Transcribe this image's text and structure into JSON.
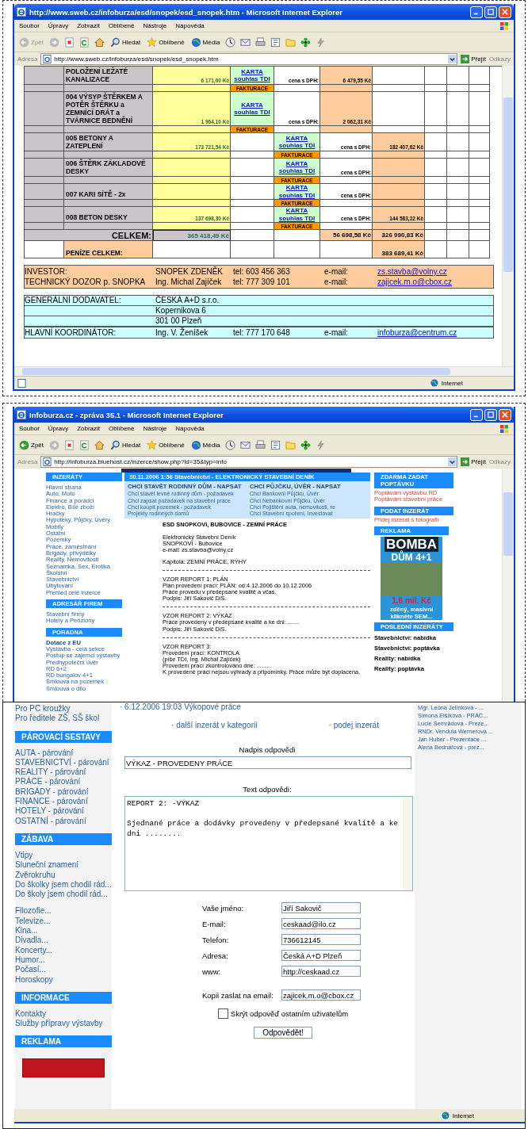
{
  "windows": [
    {
      "kind": "table",
      "title": "http://www.sweb.cz/infoburza/esd/snopek/esd_snopek.htm - Microsoft Internet Explorer",
      "menu": [
        "Soubor",
        "Úpravy",
        "Zobrazit",
        "Oblíbené",
        "Nástroje",
        "Nápověda"
      ],
      "toolbar": {
        "back": "Zpět",
        "back_disabled": true,
        "search": "Hledat",
        "favorites": "Oblíbené",
        "media": "Média"
      },
      "address": {
        "label": "Adresa",
        "url": "http://www.sweb.cz/infoburza/esd/snopek/esd_snopek.htm",
        "go": "Přejít",
        "links": "Odkazy"
      },
      "status": "Internet"
    },
    {
      "kind": "portal",
      "title": "Infoburza.cz - zpráva 35.1 - Microsoft Internet Explorer",
      "menu": [
        "Soubor",
        "Úpravy",
        "Zobrazit",
        "Oblíbené",
        "Nástroje",
        "Nápověda"
      ],
      "toolbar": {
        "back": "Zpět",
        "back_disabled": false,
        "search": "Hledat",
        "favorites": "Oblíbené",
        "media": "Média"
      },
      "address": {
        "label": "Adresa",
        "url": "http://infoburza.bluehost.cz/inzerce/show.php?id=35&typ=info",
        "go": "Přejít",
        "links": "Odkazy"
      }
    }
  ],
  "budget": {
    "items": [
      {
        "kind": "first",
        "name": "POLOŽENÍ LEŽATÉ KANALIZACE",
        "price": "6 171,00 Kč",
        "card": "KARTA souhlas TDI",
        "vat_label": "cena s DPH:",
        "vat_price": "6 479,55 Kč",
        "invoice": "FAKTURACE"
      },
      {
        "kind": "first",
        "name": "004 VÝSYP ŠTĚRKEM A POTĚR ŠTĚRKU a ZEMNÍCÍ DRÁT a TVÁRNICE BEDNĚNÍ",
        "price": "1 964,10 Kč",
        "card": "KARTA souhlas TDI",
        "vat_label": "cena s DPH:",
        "vat_price": "2 062,31 Kč",
        "invoice": "FAKTURACE"
      },
      {
        "kind": "second",
        "name": "005 BETONY A ZATEPLENÍ",
        "price": "173 721,54 Kč",
        "card": "KARTA souhlas TDI",
        "vat_label": "cena s DPH:",
        "vat_price": "182 407,62 Kč",
        "invoice": "FAKTURACE"
      },
      {
        "kind": "second",
        "name": "006 ŠTĚRK ZÁKLADOVÉ DESKY",
        "card": "KARTA souhlas TDI",
        "vat_label": "cena s DPH:",
        "invoice": "FAKTURACE"
      },
      {
        "kind": "second",
        "name": "007 KARI SÍTĚ - 2x",
        "card": "KARTA souhlas TDI",
        "vat_label": "cena s DPH:",
        "invoice": "FAKTURACE"
      },
      {
        "kind": "second",
        "name": "008 BETON DESKY",
        "price": "137 698,30 Kč",
        "card": "KARTA souhlas TDI",
        "vat_label": "cena s DPH:",
        "vat_price": "144 583,22 Kč",
        "invoice": "FAKTURACE"
      }
    ],
    "total": {
      "label": "CELKEM:",
      "price": "365 418,49 Kč",
      "vat_first": "56 698,58 Kč",
      "vat_second": "326 990,83 Kč"
    },
    "grand_total": {
      "label": "PENÍZE CELKEM:",
      "value": "383 689,41 Kč"
    },
    "contacts": [
      {
        "role": "INVESTOR:",
        "name": "SNOPEK ZDENĚK",
        "tel": "tel: 603 456 363",
        "email_label": "e-mail:",
        "email": "zs.stavba@volny.cz"
      },
      {
        "role": "TECHNICKÝ DOZOR p. SNOPKA",
        "name": "Ing. Michal Zajíček",
        "tel": "tel: 777 309 101",
        "email_label": "e-mail:",
        "email": "zajicek.m.o@cbox.cz"
      }
    ],
    "supplier": {
      "label": "GENERÁLNÍ DODAVATEL:",
      "lines": [
        "ČESKÁ A+D s.r.o.",
        "Kopernikova 6",
        "301 00 Plzeň"
      ]
    },
    "coordinator": {
      "role": "HLAVNÍ KOORDINÁTOR:",
      "name": "Ing. V. Ženíšek",
      "tel": "tel: 777 170 648",
      "email_label": "e-mail:",
      "email": "infoburza@centrum.cz"
    }
  },
  "portal": {
    "nav": [
      {
        "heading": "INZERÁTY",
        "items": [
          "Hlavní strana",
          "Auto, Moto",
          "Finance a poradci",
          "Elektro, Bílé zboží",
          "Hračky",
          "Hypotéky, Půjčky, Úvěry",
          "Mobily",
          "Ostatní",
          "Pozemky",
          "Práce, zaměstnání",
          "Brigády, přivýdělky",
          "Reality, Nemovitosti",
          "Seznamka, Sex, Erotika",
          "Školství",
          "Stavebnictví",
          "Ubytování",
          "Přehled celé inzerce"
        ]
      },
      {
        "heading": "ADRESÁŘ FIREM",
        "items": [
          "Stavební firmy",
          "Hotely a Penziony"
        ]
      },
      {
        "heading": "PORADNA",
        "lead": "Dotace z EU",
        "items": [
          "Výstavba - celá sekce",
          "Postup se zájemci výstavby",
          "Předhypoteční úvěr",
          "RD 6+2",
          "RD bungalov 4+1",
          "Smlouva na pozemek",
          "Smlouva o dílo"
        ]
      }
    ],
    "header": "30.11.2006 1:56 Stavebnictví - ELEKTRONICKÝ STAVEBNÍ DENÍK",
    "link_columns": [
      {
        "heading": "CHCI STAVĚT RODINNÝ DŮM - NAPSAT",
        "links": [
          "Chci stavět levně rodinný dům - požadavek",
          "Chci zapsat požadavek na stavební práce",
          "Chci koupit pozemek - požadavek",
          "Projekty rodinných domů"
        ]
      },
      {
        "heading": "CHCI PŮJČKU, ÚVĚR - NAPSAT",
        "links": [
          "Chci Bankovní Půjčku, Úvěr",
          "Chci Nebankovní Půjčku, Úvěr",
          "Chci Pojištění auta, nemovitosti, re",
          "Chci Stavební spoření, Investovat"
        ]
      }
    ],
    "article_title": "ESD SNOPKOVI, BUBOVICE - ZEMNÍ PRÁCE",
    "blocks": [
      {
        "lines": [
          "Elektronický Stavební Deník",
          "SNOPKOVI - Bubovice",
          "e-mail: zs.stavba@volny.cz"
        ],
        "divider": false
      },
      {
        "lines": [
          "Kapitola: ZEMNÍ PRÁCE, RÝHY"
        ],
        "divider": true
      },
      {
        "lines": [
          "VZOR REPORT 1: PLÁN",
          "Plán provedení prací: PLÁN: od:4.12.2006 do 10.12.2006",
          "Práce provedu v předepsané kvalitě a včas.",
          "Podpis: Jiří Sakovič DiS."
        ],
        "divider": true
      },
      {
        "lines": [
          "VZOR REPORT 2: VÝKAZ",
          "Práce provedeny v předepsané kvalitě a ke dni: .......",
          "Podpis: Jiří Sakovič DiS."
        ],
        "divider": true
      },
      {
        "lines": [
          "VZOR REPORT 3:",
          "Provedení prací: KONTROLA",
          "(píše TDI, Ing. Michal Zajíček)",
          "Provedení prací zkontrolováno dne: .........",
          "K provedené práci nejsou výhrady a připomínky. Práce může být doplacena."
        ],
        "divider": false
      }
    ],
    "side": [
      {
        "heading": "ZDARMA ZADAT POPTÁVKU",
        "links": [
          "Poptávám výstavbu RD",
          "Poptávám stavební práce"
        ]
      },
      {
        "heading": "PODAT INZERÁT",
        "links": [
          "Přidej inzerát s fotografií"
        ]
      }
    ],
    "ad_heading": "REKLAMA",
    "ad": {
      "title": "BOMBA",
      "subtitle": "DŮM 4+1",
      "price": "1,6 mil. Kč",
      "lines": [
        "zděný, masivní",
        "klikněte SEM..."
      ]
    },
    "latest_heading": "POSLEDNÍ INZERÁTY",
    "latest": [
      "Stavebnictví: nabídka",
      "Stavebnictví: poptávka",
      "Reality: nabídka",
      "Reality: poptávka"
    ]
  },
  "reply_page": {
    "nav": [
      {
        "items": [
          "Pro PC kroužky",
          "Pro ředitele ZŠ, SŠ škol"
        ]
      },
      {
        "heading": "PÁROVACÍ SESTAVY",
        "items": [
          "AUTA - párování",
          "STAVEBNICTVÍ - párování",
          "REALITY - párování",
          "PRÁCE - párování",
          "BRIGÁDY - párování",
          "FINANCE - párování",
          "HOTELY - párování",
          "OSTATNÍ - párování"
        ]
      },
      {
        "heading": "ZÁBAVA",
        "items": [
          "Vtipy",
          "Sluneční znamení",
          "Zvěrokruhu",
          "Do školky jsem chodil rád...",
          "Do školy jsem chodil rád..."
        ]
      },
      {
        "items": [
          "Filozofie...",
          "Televize...",
          "Kina...",
          "Divadla...",
          "Koncerty...",
          "Humor...",
          "Počasí...",
          "Horoskopy"
        ]
      },
      {
        "heading": "INFORMACE",
        "items": [
          "Kontakty",
          "Služby přípravy výstavby"
        ]
      },
      {
        "heading": "REKLAMA"
      }
    ],
    "top_link": "· 6.12.2006 19:03 Výkopové práce",
    "actions": [
      "· další inzerát v kategorii",
      "· podej inzerát"
    ],
    "form": {
      "title_label": "Nadpis odpovědi",
      "title_value": "VÝKAZ - PROVEDENY PRÁCE",
      "text_label": "Text odpovědi:",
      "text_value": "REPORT 2: -VÝKAZ\n\nSjednané práce a dodávky provedeny v předepsané kvalitě a ke dni ........",
      "fields": [
        {
          "label": "Vaše jméno:",
          "value": "Jiří Sakovič"
        },
        {
          "label": "E-mail:",
          "value": "ceskaad@ilo.cz"
        },
        {
          "label": "Telefon:",
          "value": "736612145"
        },
        {
          "label": "Adresa:",
          "value": "Česká A+D Plzeň"
        },
        {
          "label": "www:",
          "value": "http://ceskaad.cz"
        }
      ],
      "copy": {
        "label": "Kopii zaslat na email:",
        "value": "zajicek.m.o@cbox.cz"
      },
      "hide": {
        "label": "Skrýt odpověď ostatním uživatelům",
        "checked": false
      },
      "submit": "Odpovědět!"
    },
    "recent": [
      "Mgr. Leona Jelínková - ...",
      "Simona Elšíková - PRAC...",
      "Lucie Semrádová - Preze...",
      "RNDr. Vendula Wernerová ...",
      "Jan Huber - Prezentace ...",
      "Alena Bednářová - prez..."
    ],
    "status": "Internet"
  }
}
